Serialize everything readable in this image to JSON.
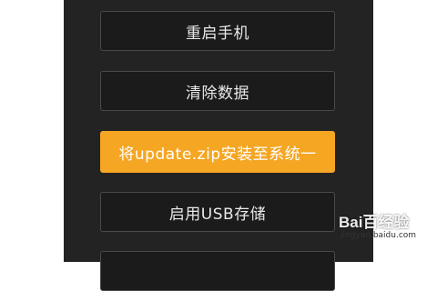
{
  "menu": {
    "items": [
      {
        "label": "重启手机"
      },
      {
        "label": "清除数据"
      },
      {
        "label": "将update.zip安装至系统一"
      },
      {
        "label": "启用USB存储"
      }
    ],
    "selected_index": 2,
    "selected_color": "#f5a623",
    "background_color": "#232323"
  },
  "watermark": {
    "logo_text": "Bai百经验",
    "url": "jingyan.baidu.com"
  }
}
